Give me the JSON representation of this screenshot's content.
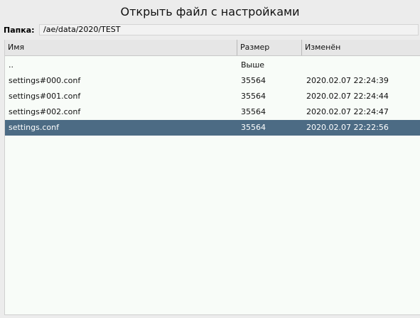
{
  "dialog": {
    "title": "Открыть файл с настройками",
    "folder_label": "Папка:",
    "folder_path": "/ae/data/2020/TEST"
  },
  "table": {
    "columns": [
      "Имя",
      "Размер",
      "Изменён"
    ],
    "rows": [
      {
        "name": "..",
        "size": "Выше",
        "modified": ""
      },
      {
        "name": "settings#000.conf",
        "size": "35564",
        "modified": "2020.02.07 22:24:39"
      },
      {
        "name": "settings#001.conf",
        "size": "35564",
        "modified": "2020.02.07 22:24:44"
      },
      {
        "name": "settings#002.conf",
        "size": "35564",
        "modified": "2020.02.07 22:24:47"
      },
      {
        "name": "settings.conf",
        "size": "35564",
        "modified": "2020.02.07 22:22:56"
      }
    ],
    "selected_index": 4
  },
  "colors": {
    "selection": "#4c6b84",
    "list_background": "#f8fcf8",
    "header_background": "#e6e6e6"
  }
}
